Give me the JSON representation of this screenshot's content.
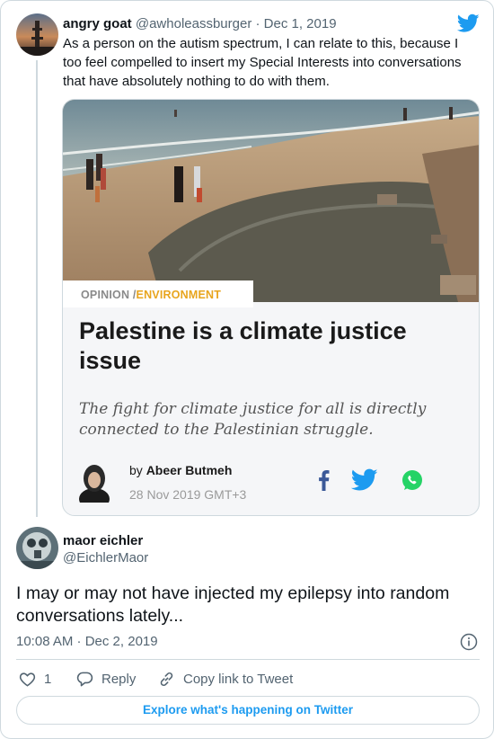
{
  "quoted_tweet": {
    "display_name": "angry goat",
    "handle_date": " @awholeassburger · Dec 1, 2019",
    "text": "As a person on the autism spectrum, I can relate to this, because I too feel compelled to insert my Special Interests into conversations that have absolutely nothing to do with them.",
    "article": {
      "tag_primary": "OPINION",
      "tag_sep": " /",
      "tag_secondary": "ENVIRONMENT",
      "headline": "Palestine is a climate justice issue",
      "subheadline": "The fight for climate justice for all is directly connected to the Palestinian struggle.",
      "by_prefix": "by ",
      "author": "Abeer Butmeh",
      "date": "28 Nov 2019 GMT+3"
    }
  },
  "main_tweet": {
    "display_name": "maor eichler",
    "handle": "@EichlerMaor",
    "text": "I may or may not have injected my epilepsy into random conversations lately...",
    "timestamp": "10:08 AM · Dec 2, 2019",
    "actions": {
      "like_count": "1",
      "reply_label": "Reply",
      "copy_label": "Copy link to Tweet"
    },
    "explore_label": "Explore what's happening on Twitter"
  },
  "colors": {
    "twitter_blue": "#1d9bf0",
    "secondary_text": "#536471",
    "border": "#cfd9de",
    "tag_accent": "#e8a51e"
  },
  "icons": [
    "twitter-bird-icon",
    "facebook-icon",
    "twitter-share-icon",
    "whatsapp-icon",
    "info-icon",
    "heart-icon",
    "reply-icon",
    "link-icon"
  ]
}
